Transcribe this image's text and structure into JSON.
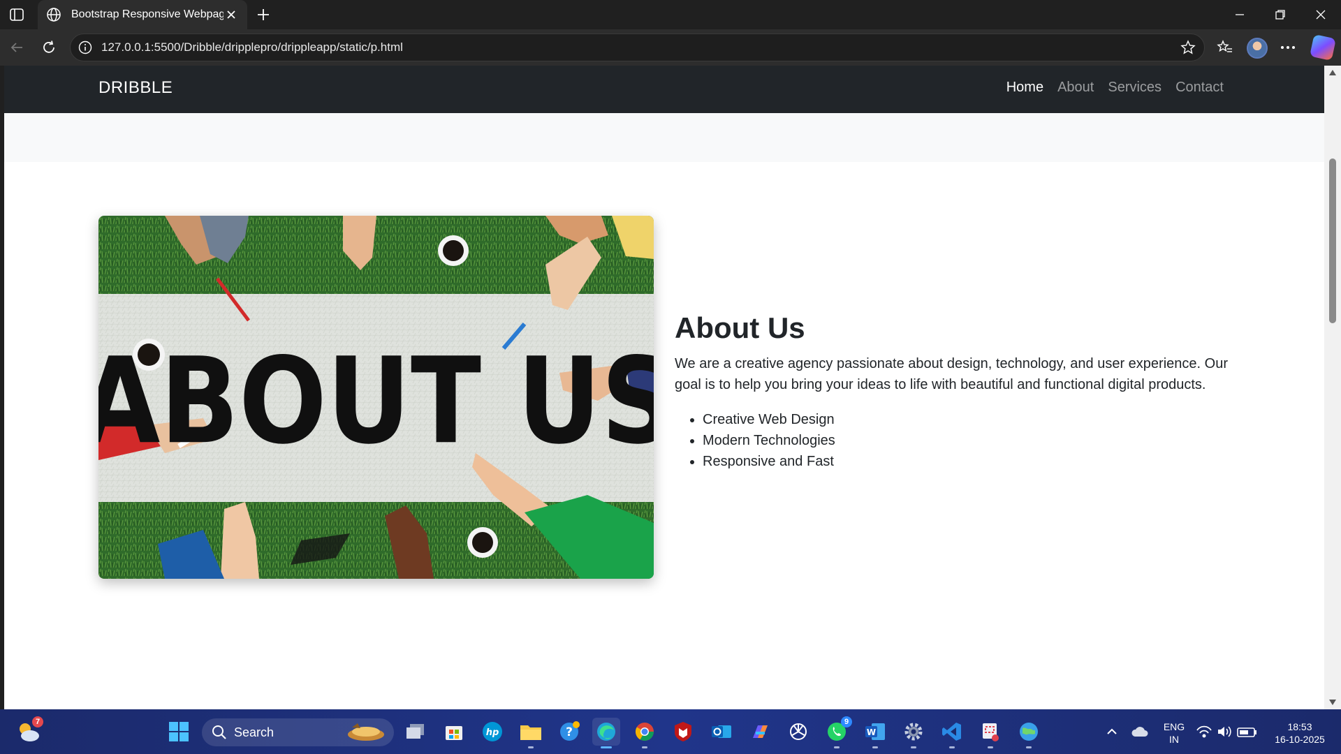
{
  "browser": {
    "tab_title": "Bootstrap Responsive Webpage",
    "url": "127.0.0.1:5500/Dribble/dripplepro/drippleapp/static/p.html"
  },
  "page": {
    "brand": "DRIBBLE",
    "nav": [
      "Home",
      "About",
      "Services",
      "Contact"
    ],
    "active_nav": "Home",
    "about": {
      "image_text": "ABOUT US",
      "heading": "About Us",
      "paragraph": "We are a creative agency passionate about design, technology, and user experience. Our goal is to help you bring your ideas to life with beautiful and functional digital products.",
      "features": [
        "Creative Web Design",
        "Modern Technologies",
        "Responsive and Fast"
      ]
    }
  },
  "taskbar": {
    "search_label": "Search",
    "weather_badge": "7",
    "whatsapp_badge": "9",
    "language": "ENG",
    "region": "IN",
    "time": "18:53",
    "date": "16-10-2025"
  },
  "colors": {
    "navbar": "#212529",
    "taskbar": "#20358a",
    "accent": "#5fb4ff"
  }
}
